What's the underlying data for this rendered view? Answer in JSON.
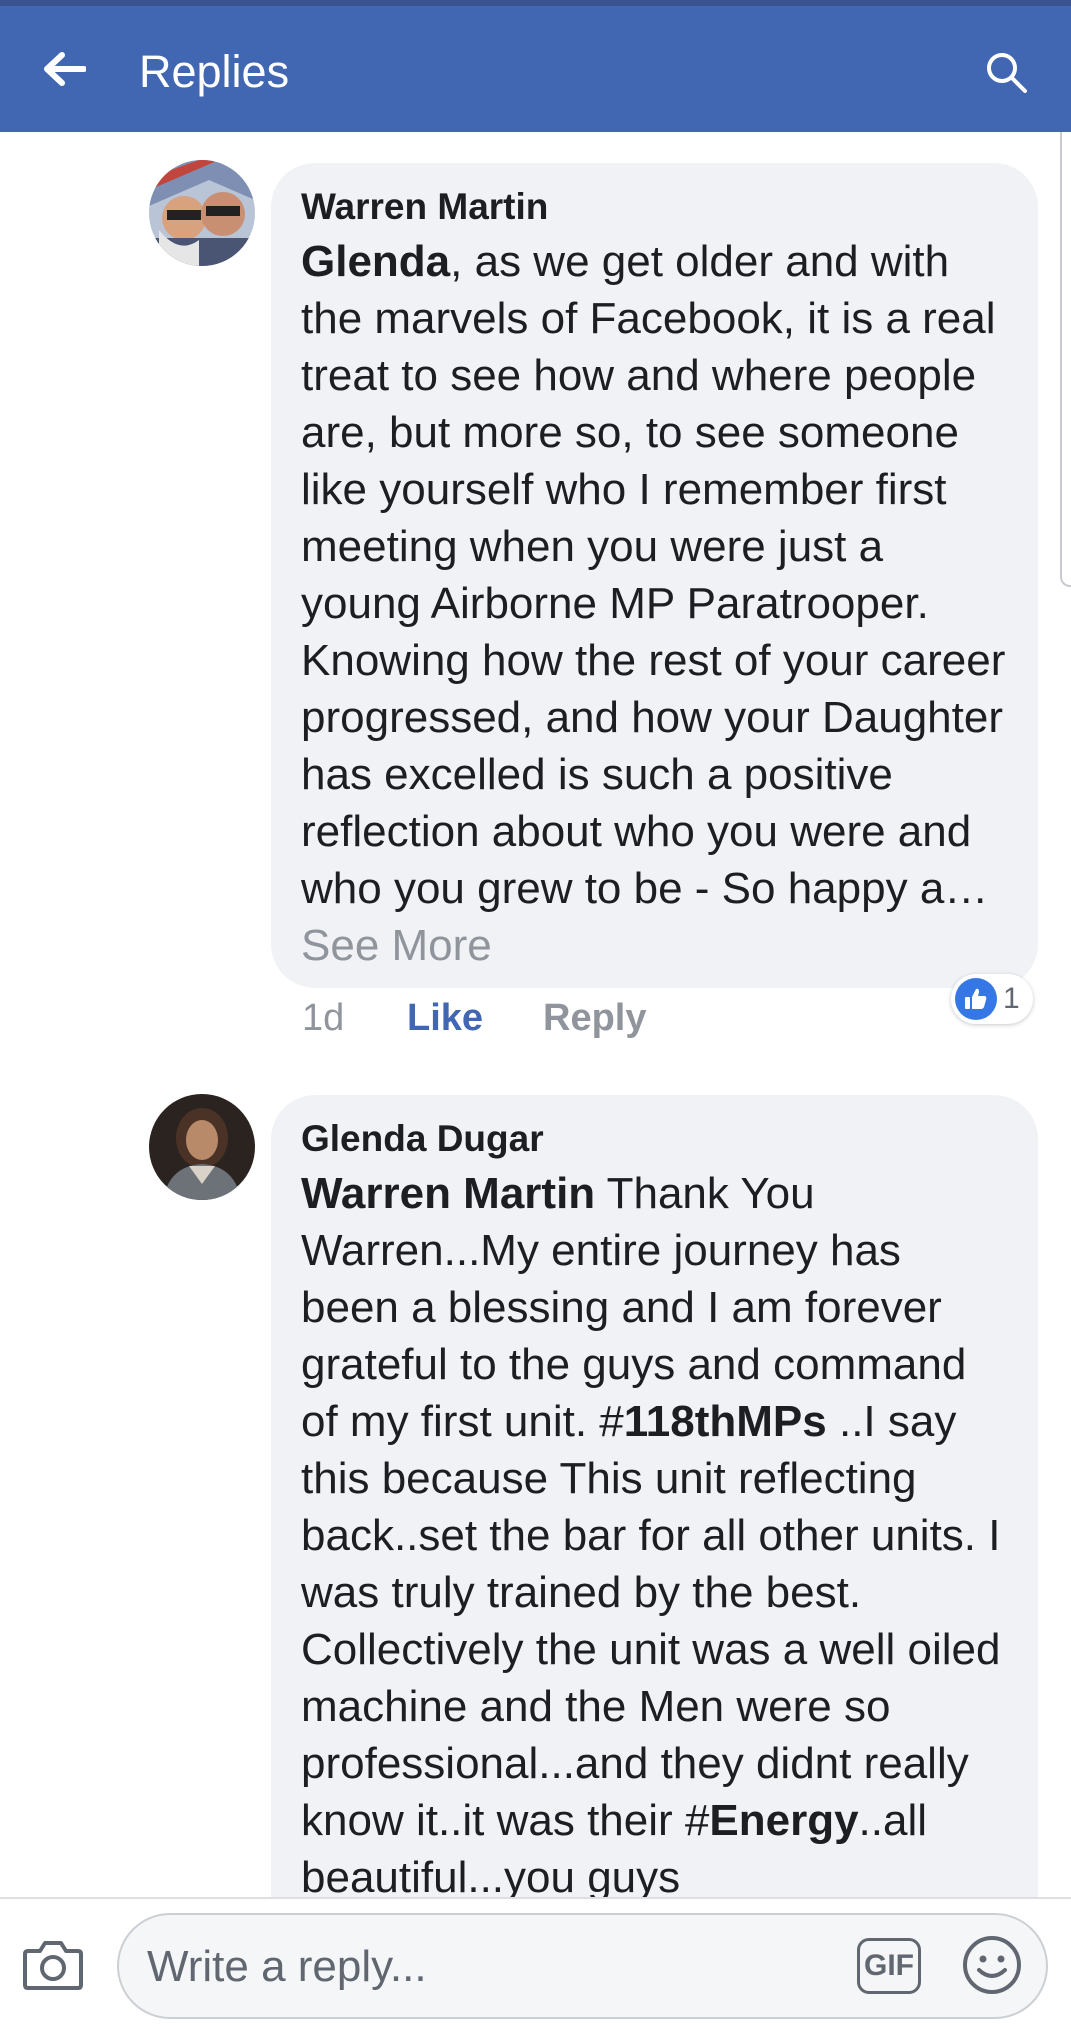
{
  "header": {
    "title": "Replies",
    "back_icon": "arrow-left-icon",
    "search_icon": "search-icon",
    "background": "#4267b2"
  },
  "comments": [
    {
      "author": "Warren Martin",
      "mention": "Glenda",
      "body_text": ", as we get older and with the marvels of Facebook, it is a real treat to see how and where people are, but more so, to see someone like yourself who I remember first meeting when you were just a young Airborne MP Paratrooper. Knowing how the rest of your career progressed, and how your Daughter has excelled is such a positive reflection about who you were and who you grew to be - So happy a…",
      "see_more": "See More",
      "time": "1d",
      "like_label": "Like",
      "reply_label": "Reply",
      "reaction_count": "1",
      "reaction_icon": "thumbs-up-icon"
    },
    {
      "author": "Glenda Dugar",
      "mention": "Warren Martin",
      "body_part1": " Thank You Warren...My entire journey has been a blessing and I am forever grateful to the guys and command of my first unit. #",
      "hashtag1": "118thMPs",
      "body_part2": " ..I say this because This unit reflecting back..set the bar for all other units. I was truly trained by the best. Collectively the unit was a well oiled machine and the Men were so professional...and they didnt really know it..it was their #",
      "hashtag2": "Energy",
      "body_part3": "..all beautiful...you guys"
    }
  ],
  "composer": {
    "placeholder": "Write a reply...",
    "gif_label": "GIF",
    "camera_icon": "camera-icon",
    "emoji_icon": "smiley-icon"
  },
  "colors": {
    "brand": "#4267b2",
    "bubble": "#f0f2f5",
    "like_reaction": "#3578e5"
  }
}
